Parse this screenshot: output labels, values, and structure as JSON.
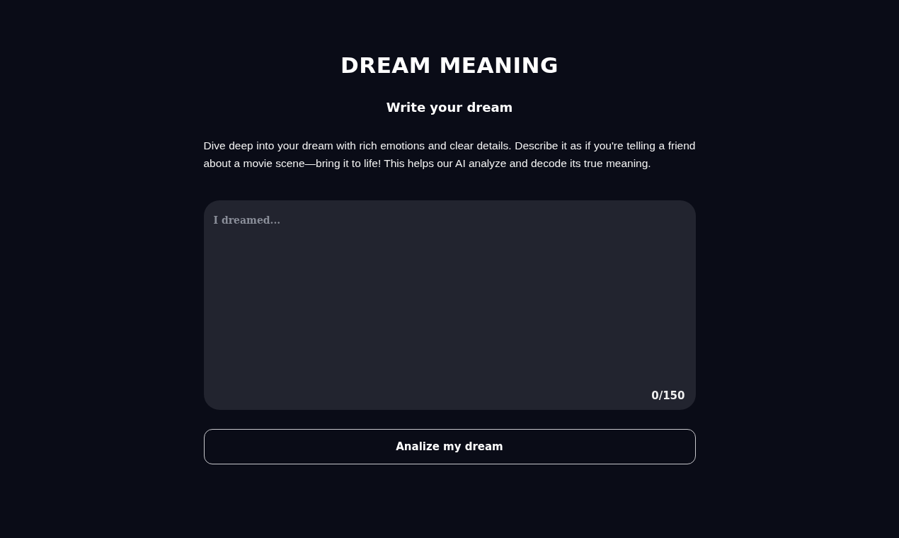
{
  "title": "DREAM MEANING",
  "subtitle": "Write your dream",
  "description": "Dive deep into your dream with rich emotions and clear details. Describe it as if you're telling a friend about a movie scene—bring it to life! This helps our AI analyze and decode its true meaning.",
  "dream_field": {
    "placeholder": "I dreamed...",
    "counter": "0/150"
  },
  "submit_button": "Analize my dream"
}
